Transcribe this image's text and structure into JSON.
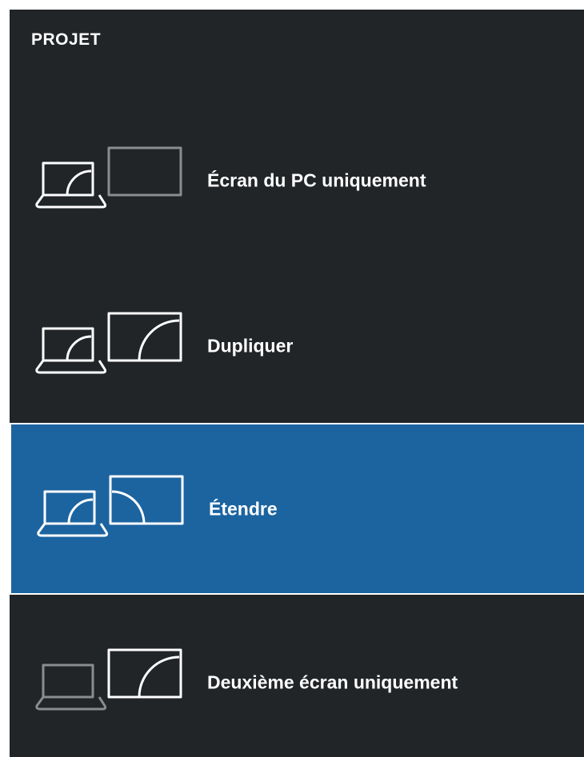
{
  "panel": {
    "title": "PROJET"
  },
  "options": [
    {
      "label": "Écran du PC uniquement",
      "icon": "pc-screen-only-icon",
      "selected": false
    },
    {
      "label": "Dupliquer",
      "icon": "duplicate-icon",
      "selected": false
    },
    {
      "label": "Étendre",
      "icon": "extend-icon",
      "selected": true
    },
    {
      "label": "Deuxième écran uniquement",
      "icon": "second-screen-only-icon",
      "selected": false
    }
  ],
  "colors": {
    "background": "#212528",
    "selected": "#1c64a0",
    "active_stroke": "#ffffff",
    "inactive_stroke": "#8a8d8f"
  }
}
